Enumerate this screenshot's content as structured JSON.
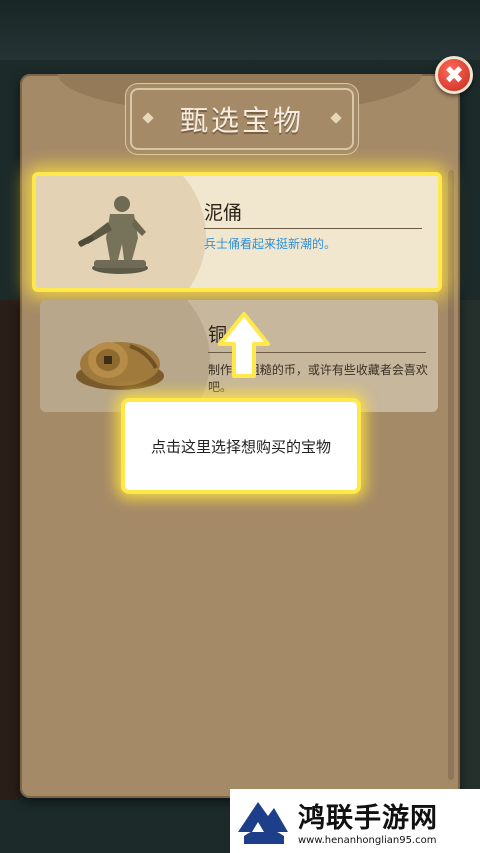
{
  "dialog": {
    "title": "甄选宝物",
    "close_label": "✖"
  },
  "items": [
    {
      "name": "泥俑",
      "description": "兵士俑看起来挺新潮的。",
      "icon": "clay-figurine-icon",
      "selected": true
    },
    {
      "name": "铜",
      "description": "制作  当粗糙的币，或许有些收藏者会喜欢吧。",
      "icon": "copper-coins-icon",
      "selected": false
    }
  ],
  "tutorial": {
    "hint": "点击这里选择想购买的宝物",
    "arrow_icon": "up-arrow-icon"
  },
  "watermark": {
    "name": "鸿联手游网",
    "url": "www.henanhonglian95.com"
  },
  "colors": {
    "panel": "#a58a68",
    "highlight": "#ffe94a",
    "desc_blue": "#2f8fd6",
    "close_red": "#d1352a"
  }
}
